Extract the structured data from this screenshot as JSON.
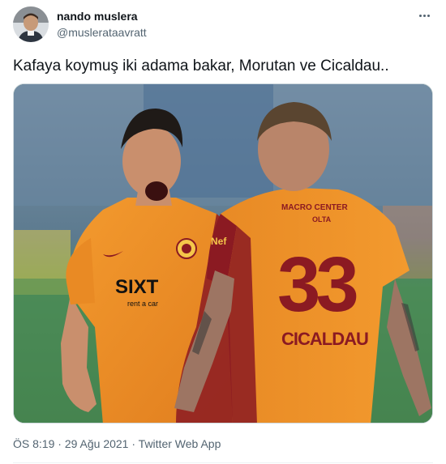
{
  "user": {
    "display_name": "nando muslera",
    "handle": "@muslerataavratt"
  },
  "tweet": {
    "text": "Kafaya koymuş iki adama bakar, Morutan ve Cicaldau..",
    "time": "ÖS 8:19",
    "separator": "·",
    "date": "29 Ağu 2021",
    "source": "Twitter Web App"
  },
  "photo": {
    "sponsor": "SIXT",
    "sponsor_sub": "rent a car",
    "sleeve_logo": "Nef",
    "player_number": "33",
    "player_name": "CICALDAU",
    "back_top_text": "MACRO CENTER",
    "back_sub_text": "OLTA"
  },
  "icons": {
    "more": "more-dots-icon"
  },
  "colors": {
    "link_gray": "#536471",
    "kit_orange": "#f0922b",
    "kit_red": "#8b1a22"
  }
}
